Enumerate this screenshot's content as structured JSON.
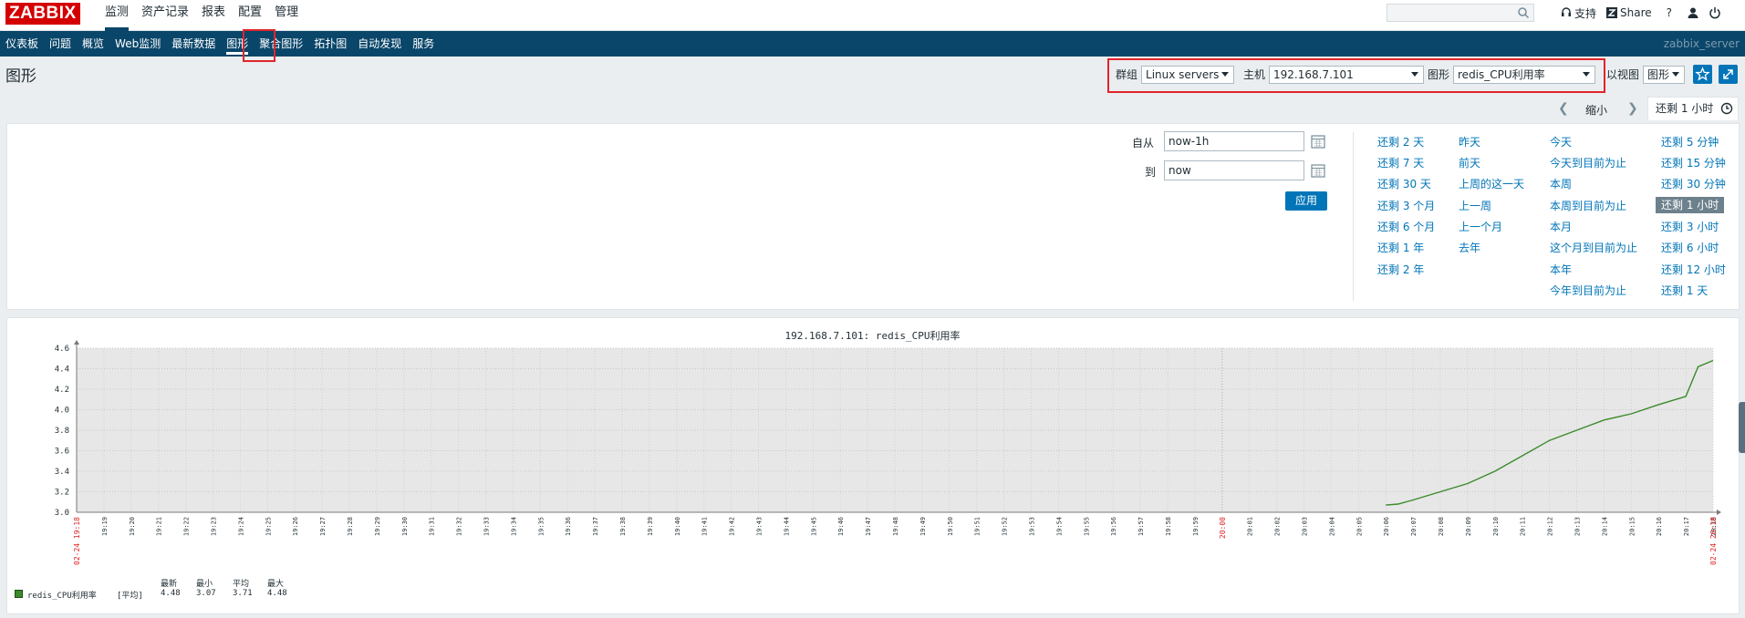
{
  "app": {
    "logo": "ZABBIX",
    "top_menu": [
      "监测",
      "资产记录",
      "报表",
      "配置",
      "管理"
    ],
    "top_links": {
      "support": "支持",
      "share": "Share",
      "help": "?"
    },
    "sub_menu": [
      "仪表板",
      "问题",
      "概览",
      "Web监测",
      "最新数据",
      "图形",
      "聚合图形",
      "拓扑图",
      "自动发现",
      "服务"
    ],
    "server_name": "zabbix_server"
  },
  "header": {
    "title": "图形",
    "group_label": "群组",
    "group_value": "Linux servers",
    "host_label": "主机",
    "host_value": "192.168.7.101",
    "graph_label": "图形",
    "graph_value": "redis_CPU利用率",
    "view_as_label": "以视图",
    "view_as_value": "图形"
  },
  "timebar": {
    "zoom_out": "缩小",
    "active_tab": "还剩 1 小时"
  },
  "filter": {
    "from_label": "自从",
    "from_value": "now-1h",
    "to_label": "到",
    "to_value": "now",
    "apply": "应用",
    "quick": [
      [
        "还剩 2 天",
        "还剩 7 天",
        "还剩 30 天",
        "还剩 3 个月",
        "还剩 6 个月",
        "还剩 1 年",
        "还剩 2 年"
      ],
      [
        "昨天",
        "前天",
        "上周的这一天",
        "上一周",
        "上一个月",
        "去年"
      ],
      [
        "今天",
        "今天到目前为止",
        "本周",
        "本周到目前为止",
        "本月",
        "这个月到目前为止",
        "本年",
        "今年到目前为止"
      ],
      [
        "还剩 5 分钟",
        "还剩 15 分钟",
        "还剩 30 分钟",
        "还剩 1 小时",
        "还剩 3 小时",
        "还剩 6 小时",
        "还剩 12 小时",
        "还剩 1 天"
      ]
    ],
    "selected_quick": "还剩 1 小时"
  },
  "chart_data": {
    "type": "line",
    "title": "192.168.7.101: redis_CPU利用率",
    "y_ticks": [
      "3.0",
      "3.2",
      "3.4",
      "3.6",
      "3.8",
      "4.0",
      "4.2",
      "4.4",
      "4.6"
    ],
    "ylim": [
      3.0,
      4.6
    ],
    "start_label": "02-24 19:18",
    "end_label": "02-24 20:18",
    "x_ticks": [
      "19:19",
      "19:20",
      "19:21",
      "19:22",
      "19:23",
      "19:24",
      "19:25",
      "19:26",
      "19:27",
      "19:28",
      "19:29",
      "19:30",
      "19:31",
      "19:32",
      "19:33",
      "19:34",
      "19:35",
      "19:36",
      "19:37",
      "19:38",
      "19:39",
      "19:40",
      "19:41",
      "19:42",
      "19:43",
      "19:44",
      "19:45",
      "19:46",
      "19:47",
      "19:48",
      "19:49",
      "19:50",
      "19:51",
      "19:52",
      "19:53",
      "19:54",
      "19:55",
      "19:56",
      "19:57",
      "19:58",
      "19:59",
      "20:00",
      "20:01",
      "20:02",
      "20:03",
      "20:04",
      "20:05",
      "20:06",
      "20:07",
      "20:08",
      "20:09",
      "20:10",
      "20:11",
      "20:12",
      "20:13",
      "20:14",
      "20:15",
      "20:16",
      "20:17",
      "20:18"
    ],
    "series": [
      {
        "name": "redis_CPU利用率",
        "color": "#3b8a2b",
        "x": [
          "20:06",
          "20:06",
          "20:07",
          "20:08",
          "20:09",
          "20:10",
          "20:11",
          "20:12",
          "20:13",
          "20:14",
          "20:15",
          "20:16",
          "20:17",
          "20:17",
          "20:18"
        ],
        "values": [
          3.07,
          3.08,
          3.12,
          3.2,
          3.28,
          3.4,
          3.55,
          3.7,
          3.8,
          3.9,
          3.96,
          4.05,
          4.13,
          4.42,
          4.48
        ]
      }
    ],
    "legend": {
      "headers": [
        "最新",
        "最小",
        "平均",
        "最大"
      ],
      "label": "redis_CPU利用率",
      "func": "[平均]",
      "values": [
        "4.48",
        "3.07",
        "3.71",
        "4.48"
      ]
    }
  }
}
